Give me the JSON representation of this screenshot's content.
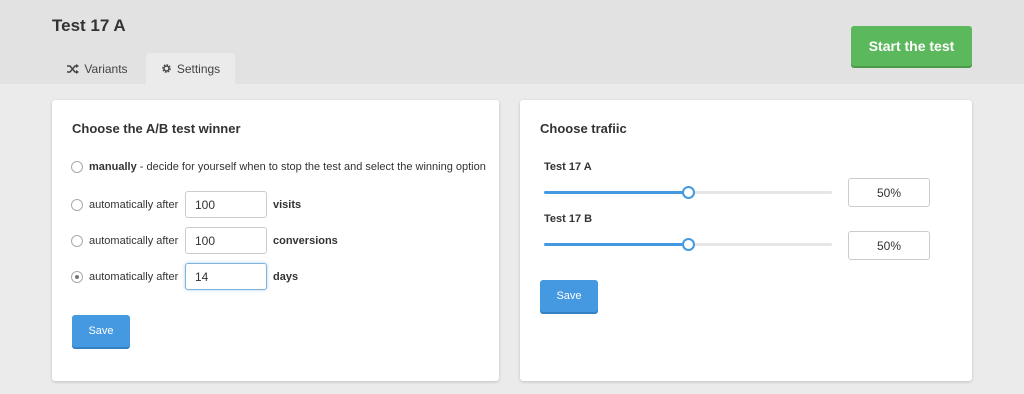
{
  "header": {
    "title": "Test 17 A",
    "start_button": "Start the test",
    "tabs": [
      {
        "label": "Variants",
        "icon": "shuffle-icon"
      },
      {
        "label": "Settings",
        "icon": "gear-icon"
      }
    ],
    "active_tab": "Settings"
  },
  "winner": {
    "title": "Choose the A/B test winner",
    "manual": {
      "bold": "manually",
      "rest": " - decide for yourself when to stop the test and select the winning option"
    },
    "options": [
      {
        "label": "automatically after",
        "value": "100",
        "unit": "visits",
        "checked": false
      },
      {
        "label": "automatically after",
        "value": "100",
        "unit": "conversions",
        "checked": false
      },
      {
        "label": "automatically after",
        "value": "14",
        "unit": "days",
        "checked": true
      }
    ],
    "save": "Save"
  },
  "traffic": {
    "title": "Choose trafiic",
    "variants": [
      {
        "label": "Test 17 A",
        "value": "50%",
        "fraction": 0.5
      },
      {
        "label": "Test 17 B",
        "value": "50%",
        "fraction": 0.5
      }
    ],
    "save": "Save"
  },
  "colors": {
    "accent": "#4499e0",
    "start": "#5cb85c"
  }
}
